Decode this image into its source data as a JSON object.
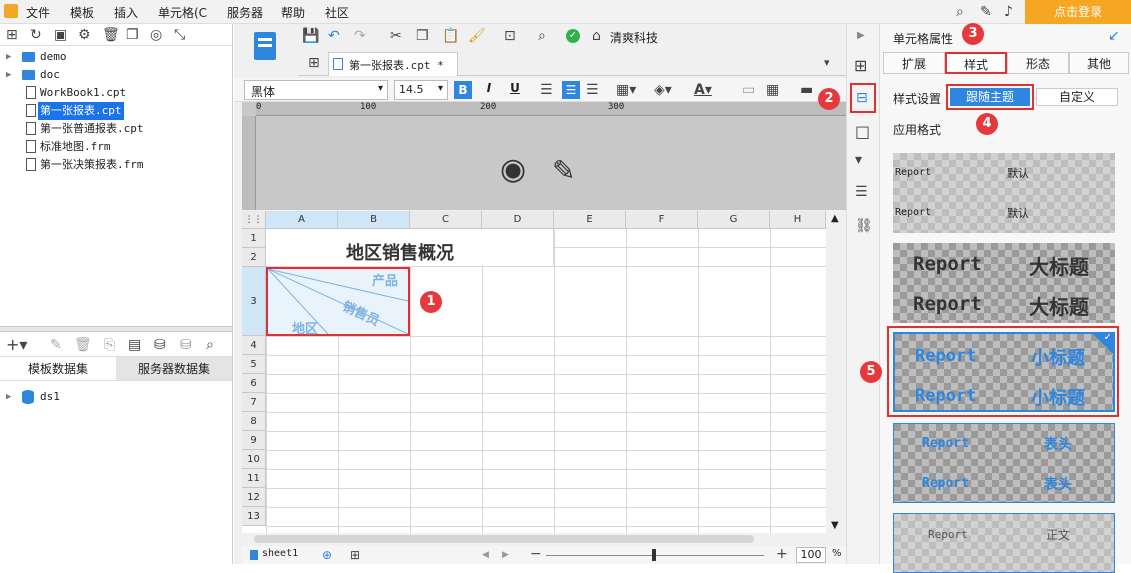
{
  "menu": [
    "文件",
    "模板",
    "插入",
    "单元格(C",
    "服务器",
    "帮助",
    "社区"
  ],
  "login_label": "点击登录",
  "toolbar": {
    "product_label": "清爽科技"
  },
  "file_tab": {
    "label": "第一张报表.cpt *"
  },
  "format": {
    "font": "黑体",
    "size": "14.5",
    "bold": "B",
    "italic": "I",
    "underline": "U"
  },
  "ruler": {
    "marks": [
      "0",
      "100",
      "200",
      "300"
    ]
  },
  "tree": [
    {
      "label": "demo",
      "type": "folder"
    },
    {
      "label": "doc",
      "type": "folder"
    },
    {
      "label": "WorkBook1.cpt",
      "type": "file"
    },
    {
      "label": "第一张报表.cpt",
      "type": "file",
      "selected": true
    },
    {
      "label": "第一张普通报表.cpt",
      "type": "file"
    },
    {
      "label": "标准地图.frm",
      "type": "file"
    },
    {
      "label": "第一张决策报表.frm",
      "type": "file"
    }
  ],
  "dataset_tabs": [
    "模板数据集",
    "服务器数据集"
  ],
  "datasets": [
    "ds1"
  ],
  "grid": {
    "columns": [
      "A",
      "B",
      "C",
      "D",
      "E",
      "F",
      "G",
      "H"
    ],
    "rows": [
      "1",
      "2",
      "3",
      "4",
      "5",
      "6",
      "7",
      "8",
      "9",
      "10",
      "11",
      "12",
      "13"
    ],
    "title": "地区销售概况",
    "slash_labels": {
      "product": "产品",
      "salesman": "销售员",
      "region": "地区"
    }
  },
  "sheet_tab": "sheet1",
  "zoom": "100",
  "zoom_unit": "%",
  "right_panel": {
    "title": "单元格属性",
    "tabs": [
      "扩展",
      "样式",
      "形态",
      "其他"
    ],
    "style_setting_label": "样式设置",
    "follow_theme": "跟随主题",
    "custom": "自定义",
    "apply_format_label": "应用格式",
    "styles": [
      {
        "left": "Report",
        "right": "默认"
      },
      {
        "left": "Report",
        "right": "大标题"
      },
      {
        "left": "Report",
        "right": "小标题"
      },
      {
        "left": "Report",
        "right": "表头"
      },
      {
        "left": "Report",
        "right": "正文"
      }
    ]
  },
  "badges": [
    "1",
    "2",
    "3",
    "4",
    "5"
  ]
}
